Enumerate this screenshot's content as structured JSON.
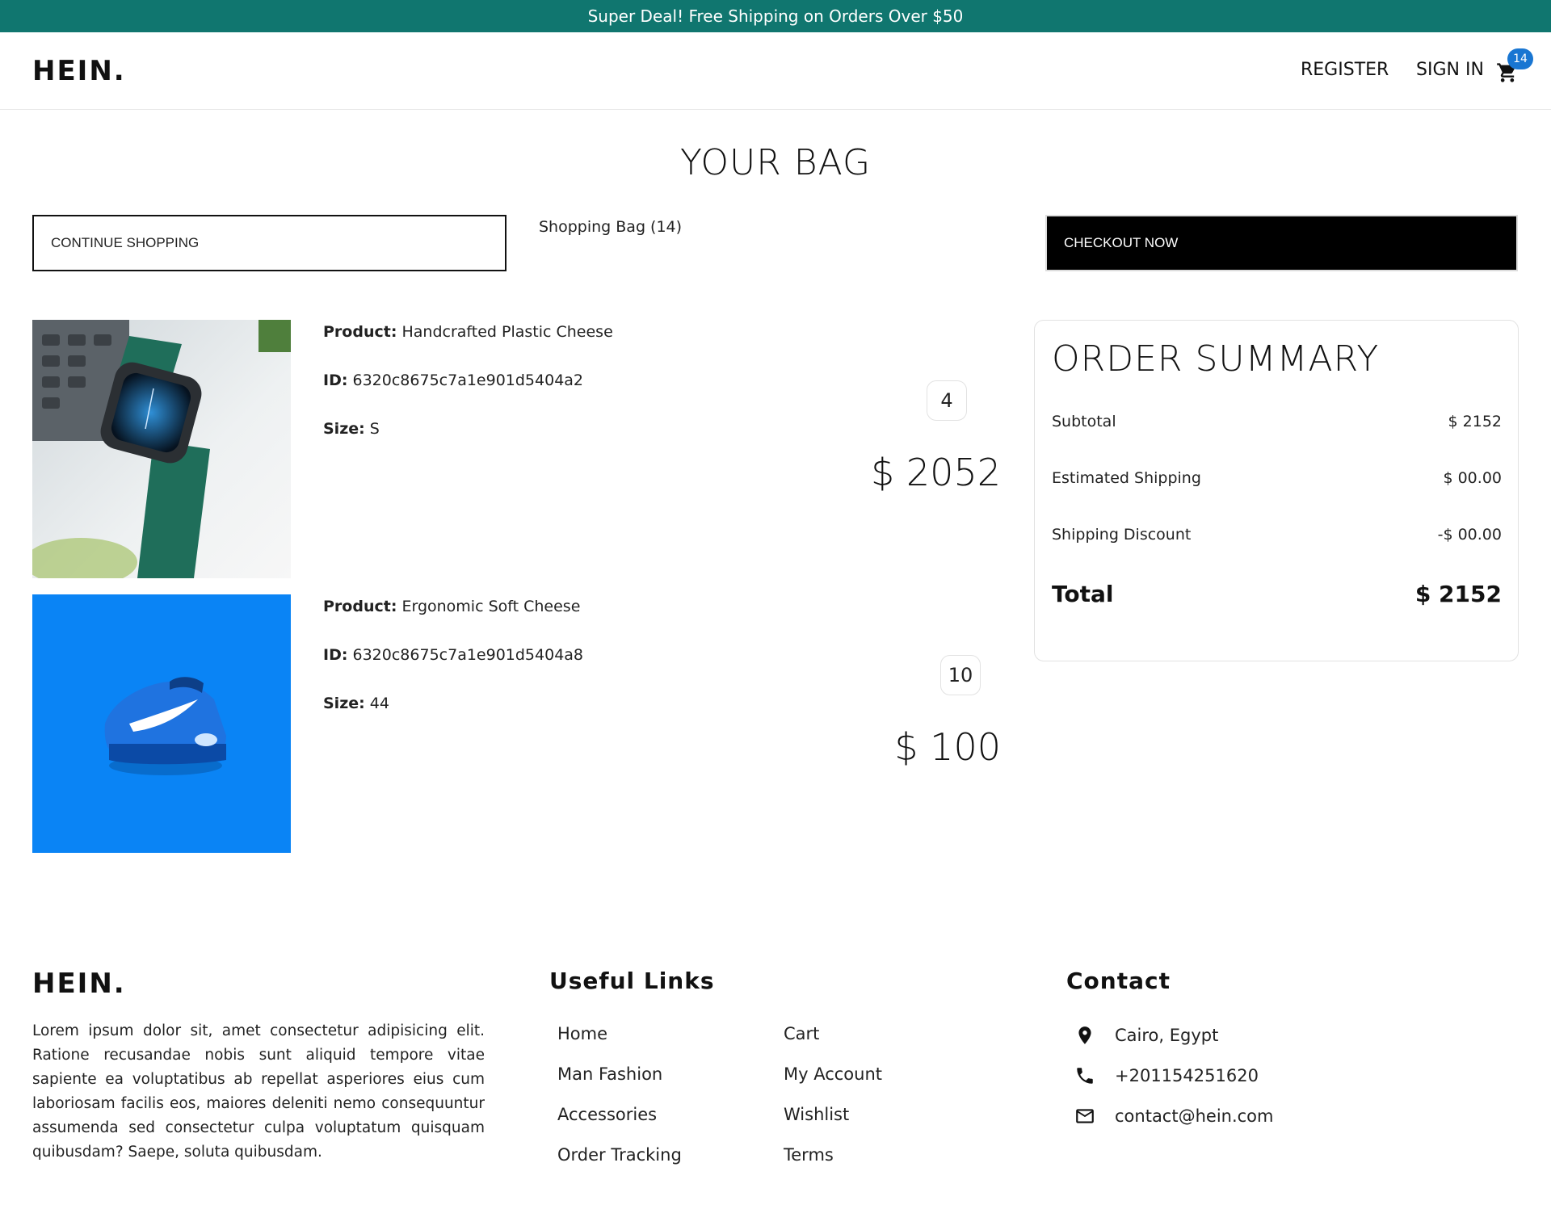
{
  "announcement": "Super Deal! Free Shipping on Orders Over $50",
  "nav": {
    "logo": "HEIN.",
    "register": "REGISTER",
    "signin": "SIGN IN",
    "cart_count": "14"
  },
  "page_title": "YOUR BAG",
  "actions": {
    "continue": "CONTINUE SHOPPING",
    "bag_count": "Shopping Bag (14)",
    "checkout": "CHECKOUT NOW"
  },
  "labels": {
    "product": "Product:",
    "id": "ID:",
    "size": "Size:"
  },
  "products": [
    {
      "name": "Handcrafted Plastic Cheese",
      "id": "6320c8675c7a1e901d5404a2",
      "size": "S",
      "quantity": "4",
      "price": "$ 2052",
      "image": "watch-image"
    },
    {
      "name": "Ergonomic Soft Cheese",
      "id": "6320c8675c7a1e901d5404a8",
      "size": "44",
      "quantity": "10",
      "price": "$ 100",
      "image": "sneaker-image"
    }
  ],
  "summary": {
    "title": "ORDER SUMMARY",
    "subtotal_label": "Subtotal",
    "subtotal": "$ 2152",
    "shipping_label": "Estimated Shipping",
    "shipping": "$ 00.00",
    "discount_label": "Shipping Discount",
    "discount": "-$ 00.00",
    "total_label": "Total",
    "total": "$ 2152"
  },
  "footer": {
    "logo": "HEIN.",
    "description": "Lorem ipsum dolor sit, amet consectetur adipisicing elit. Ratione recusandae nobis sunt aliquid tempore vitae sapiente ea voluptatibus ab repellat asperiores eius cum laboriosam facilis eos, maiores deleniti nemo consequuntur assumenda sed consectetur culpa voluptatum quisquam quibusdam? Saepe, soluta quibusdam.",
    "links_title": "Useful Links",
    "links": [
      "Home",
      "Man Fashion",
      "Accessories",
      "Order Tracking",
      "Cart",
      "My Account",
      "Wishlist",
      "Terms"
    ],
    "contact_title": "Contact",
    "address": "Cairo, Egypt",
    "phone": "+201154251620",
    "email": "contact@hein.com"
  },
  "colors": {
    "announcement_bg": "#10766f",
    "badge": "#1976d2",
    "sneaker_bg": "#0a84f5"
  },
  "icons": {
    "cart": "cart-icon",
    "location": "location-pin-icon",
    "phone": "phone-icon",
    "mail": "mail-icon"
  }
}
